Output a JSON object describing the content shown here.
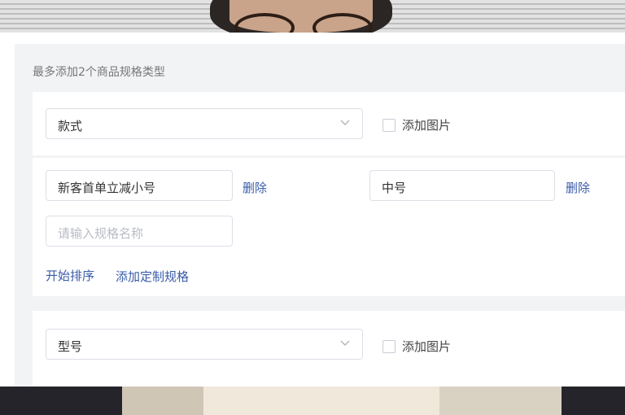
{
  "form": {
    "hint": "最多添加2个商品规格类型",
    "spec_groups": [
      {
        "type_value": "款式",
        "add_image_label": "添加图片",
        "values": [
          {
            "value": "新客首单立减小号",
            "delete_label": "删除"
          },
          {
            "value": "中号",
            "delete_label": "删除"
          }
        ],
        "new_value_placeholder": "请输入规格名称",
        "sort_label": "开始排序",
        "add_custom_label": "添加定制规格"
      },
      {
        "type_value": "型号",
        "add_image_label": "添加图片"
      }
    ]
  },
  "icons": {
    "select_arrow": "chevron-down-icon",
    "checkbox": "checkbox-icon"
  },
  "colors": {
    "link": "#3a5ba8",
    "panel_bg": "#f2f3f5",
    "border": "#dcdfe6"
  }
}
